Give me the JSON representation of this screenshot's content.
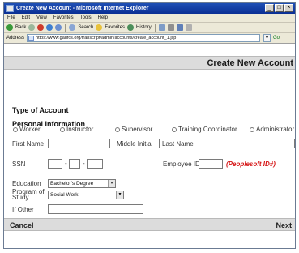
{
  "window": {
    "title": "Create New Account - Microsoft Internet Explorer",
    "controls": [
      "_",
      "□",
      "×"
    ]
  },
  "menubar": {
    "items": [
      "File",
      "Edit",
      "View",
      "Favorites",
      "Tools",
      "Help"
    ]
  },
  "toolbar": {
    "back_label": "Back",
    "search_label": "Search",
    "favorites_label": "Favorites",
    "history_label": "History"
  },
  "addressbar": {
    "label": "Address",
    "url": "https://www.gadfcs.org/transcript/admin/accounts/create_account_1.jsp",
    "go_label": "Go"
  },
  "page": {
    "title": "Create New Account",
    "type_heading": "Type of Account",
    "account_types": [
      "Worker",
      "Instructor",
      "Supervisor",
      "Training Coordinator",
      "Administrator"
    ],
    "personal_heading": "Personal Information",
    "first_name_label": "First Name",
    "middle_initial_label": "Middle Initial",
    "last_name_label": "Last Name",
    "ssn_label": "SSN",
    "ssn_dash": "-",
    "employee_id_label": "Employee ID",
    "employee_id_note": "(Peoplesoft ID#)",
    "education_label": "Education",
    "education_value": "Bachelor's Degree",
    "program_label_1": "Program of",
    "program_label_2": "Study",
    "program_value": "Social Work",
    "if_other_label": "If Other",
    "cancel_label": "Cancel",
    "next_label": "Next"
  },
  "colors": {
    "titlebar": "#0a2f94",
    "chrome": "#ece9d8",
    "header_band": "#dcdcdc",
    "note_red": "#d51414"
  }
}
